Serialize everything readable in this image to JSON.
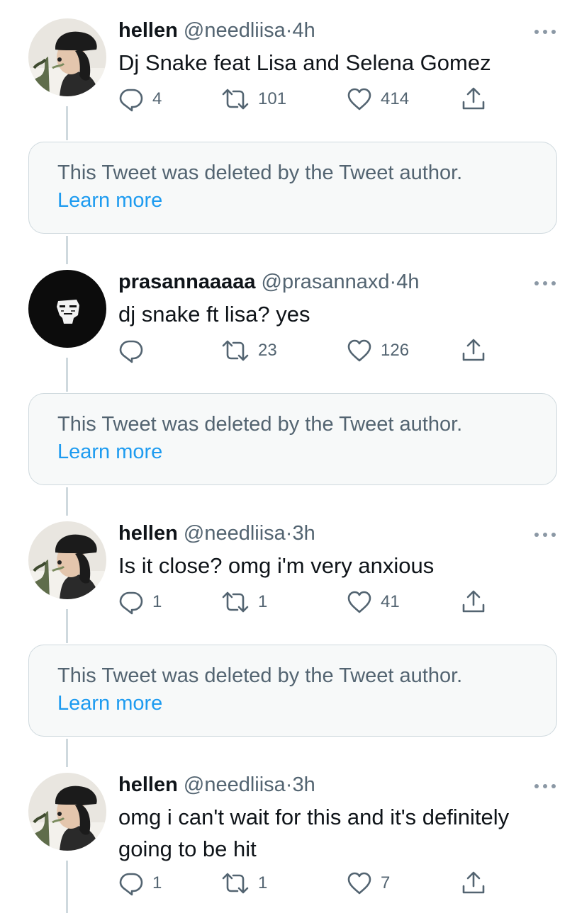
{
  "colors": {
    "text": "#0f1419",
    "secondary": "#536471",
    "link": "#1d9bf0",
    "border": "#cfd9de",
    "deleted_bg": "#f7f9f9"
  },
  "icons": {
    "reply": "reply-icon",
    "retweet": "retweet-icon",
    "like": "heart-icon",
    "share": "share-icon",
    "more": "more-icon"
  },
  "tweets": [
    {
      "name": "hellen",
      "handle": "@needliisa",
      "separator": "·",
      "time": "4h",
      "text": "Dj Snake feat Lisa and Selena Gomez",
      "replies": "4",
      "retweets": "101",
      "likes": "414"
    },
    {
      "name": "prasannaaaaa",
      "handle": "@prasannaxd",
      "separator": "·",
      "time": "4h",
      "text": "dj snake ft lisa? yes",
      "replies": "",
      "retweets": "23",
      "likes": "126"
    },
    {
      "name": "hellen",
      "handle": "@needliisa",
      "separator": "·",
      "time": "3h",
      "text": "Is it close? omg i'm very anxious",
      "replies": "1",
      "retweets": "1",
      "likes": "41"
    },
    {
      "name": "hellen",
      "handle": "@needliisa",
      "separator": "·",
      "time": "3h",
      "text": "omg i can't wait for this and it's definitely going to be hit",
      "replies": "1",
      "retweets": "1",
      "likes": "7"
    }
  ],
  "deleted_notices": [
    {
      "text": "This Tweet was deleted by the Tweet author.",
      "link": "Learn more"
    },
    {
      "text": "This Tweet was deleted by the Tweet author.",
      "link": "Learn more"
    },
    {
      "text": "This Tweet was deleted by the Tweet author.",
      "link": "Learn more"
    }
  ]
}
